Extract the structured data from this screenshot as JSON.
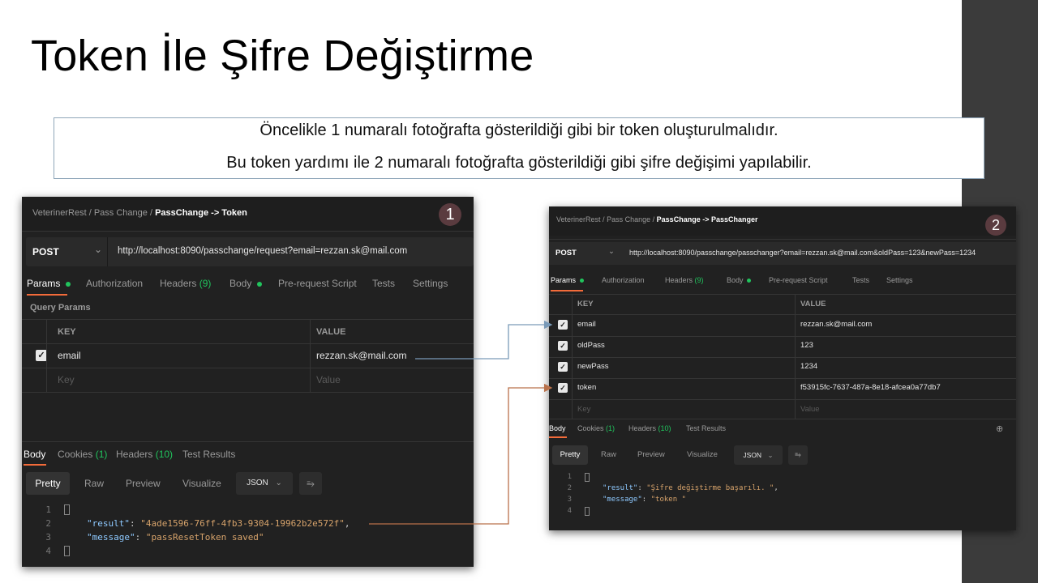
{
  "slide": {
    "title": "Token İle Şifre Değiştirme",
    "intro_line1": "Öncelikle 1 numaralı fotoğrafta gösterildiği gibi bir token oluşturulmalıdır.",
    "intro_line2": "Bu token yardımı ile 2 numaralı fotoğrafta gösterildiği gibi şifre değişimi yapılabilir."
  },
  "colors": {
    "connector_blue": "#7a9ab8",
    "connector_orange": "#b9714a",
    "accent_underline": "#f26b3a",
    "green_indicator": "#21c45d",
    "badge": "#5a3b3f"
  },
  "shot1": {
    "badge": "1",
    "breadcrumb": {
      "part1": "VeterinerRest",
      "sep1": "/",
      "part2": "Pass Change",
      "sep2": "/",
      "current": "PassChange -> Token"
    },
    "method": "POST",
    "method_caret": "⌄",
    "url": "http://localhost:8090/passchange/request?email=rezzan.sk@mail.com",
    "tabs": {
      "params": "Params",
      "authorization": "Authorization",
      "headers": "Headers",
      "headers_count": "(9)",
      "body": "Body",
      "prerequest": "Pre-request Script",
      "tests": "Tests",
      "settings": "Settings"
    },
    "query_params_label": "Query Params",
    "col_key": "KEY",
    "col_value": "VALUE",
    "param_key": "email",
    "param_value": "rezzan.sk@mail.com",
    "key_placeholder": "Key",
    "value_placeholder": "Value",
    "resp_tabs": {
      "body": "Body",
      "cookies": "Cookies",
      "cookies_count": "(1)",
      "headers": "Headers",
      "headers_count": "(10)",
      "test_results": "Test Results"
    },
    "view_buttons": {
      "pretty": "Pretty",
      "raw": "Raw",
      "preview": "Preview",
      "visualize": "Visualize",
      "format": "JSON",
      "format_caret": "⌄"
    },
    "lines": [
      "1",
      "2",
      "3",
      "4"
    ],
    "json_result_key": "\"result\"",
    "json_result_val": "\"4ade1596-76ff-4fb3-9304-19962b2e572f\"",
    "json_message_key": "\"message\"",
    "json_message_val": "\"passResetToken saved\""
  },
  "shot2": {
    "badge": "2",
    "breadcrumb": {
      "part1": "VeterinerRest",
      "sep1": "/",
      "part2": "Pass Change",
      "sep2": "/",
      "current": "PassChange -> PassChanger"
    },
    "method": "POST",
    "method_caret": "⌄",
    "url": "http://localhost:8090/passchange/passchanger?email=rezzan.sk@mail.com&oldPass=123&newPass=1234",
    "tabs": {
      "params": "Params",
      "authorization": "Authorization",
      "headers": "Headers",
      "headers_count": "(9)",
      "body": "Body",
      "prerequest": "Pre-request Script",
      "tests": "Tests",
      "settings": "Settings"
    },
    "col_key": "KEY",
    "col_value": "VALUE",
    "params": [
      {
        "key": "email",
        "value": "rezzan.sk@mail.com"
      },
      {
        "key": "oldPass",
        "value": "123"
      },
      {
        "key": "newPass",
        "value": "1234"
      },
      {
        "key": "token",
        "value": "f53915fc-7637-487a-8e18-afcea0a77db7"
      }
    ],
    "key_placeholder": "Key",
    "value_placeholder": "Value",
    "resp_tabs": {
      "body": "Body",
      "cookies": "Cookies",
      "cookies_count": "(1)",
      "headers": "Headers",
      "headers_count": "(10)",
      "test_results": "Test Results"
    },
    "view_buttons": {
      "pretty": "Pretty",
      "raw": "Raw",
      "preview": "Preview",
      "visualize": "Visualize",
      "format": "JSON",
      "format_caret": "⌄"
    },
    "lines": [
      "1",
      "2",
      "3",
      "4"
    ],
    "json_result_key": "\"result\"",
    "json_result_val": "\"Şifre değiştirme başarılı. \"",
    "json_message_key": "\"message\"",
    "json_message_val": "\"token \""
  }
}
